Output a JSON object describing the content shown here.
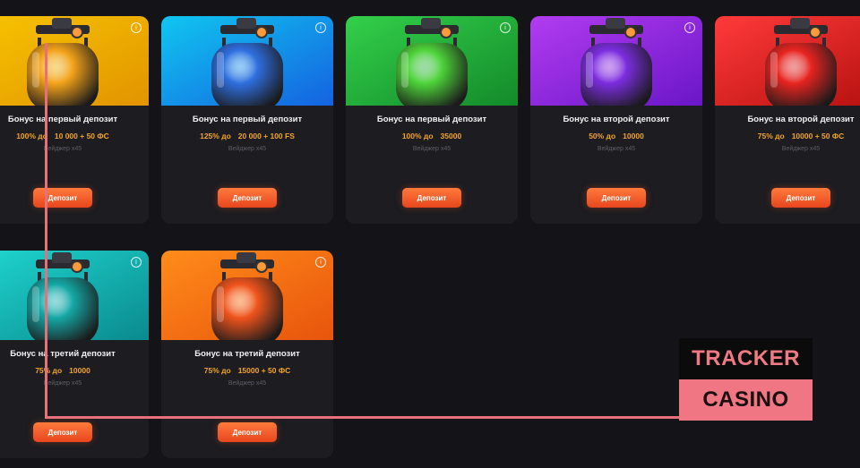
{
  "cards": [
    {
      "title": "Бонус на первый депозит",
      "percent": "100% до",
      "amount": "10 000 + 50 ФС",
      "wager": "Вейджер х45",
      "button": "Депозит",
      "info_icon": "i",
      "bg_from": "#f7c400",
      "bg_to": "#e29400",
      "bottle": "#f3a21a"
    },
    {
      "title": "Бонус на первый депозит",
      "percent": "125% до",
      "amount": "20 000 + 100 FS",
      "wager": "Вейджер х45",
      "button": "Депозит",
      "info_icon": "i",
      "bg_from": "#10c6f0",
      "bg_to": "#1562e0",
      "bottle": "#2f6fe0"
    },
    {
      "title": "Бонус на первый депозит",
      "percent": "100% до",
      "amount": "35000",
      "wager": "Вейджер х45",
      "button": "Депозит",
      "info_icon": "i",
      "bg_from": "#33d04a",
      "bg_to": "#138a2a",
      "bottle": "#4ed43a"
    },
    {
      "title": "Бонус на второй депозит",
      "percent": "50% до",
      "amount": "10000",
      "wager": "Вейджер х45",
      "button": "Депозит",
      "info_icon": "i",
      "bg_from": "#b23cf0",
      "bg_to": "#6a16c8",
      "bottle": "#7c2de0"
    },
    {
      "title": "Бонус на второй депозит",
      "percent": "75% до",
      "amount": "10000 + 50 ФС",
      "wager": "Вейджер х45",
      "button": "Депозит",
      "info_icon": "i",
      "bg_from": "#ff3a3a",
      "bg_to": "#b3100e",
      "bottle": "#e82420"
    },
    {
      "title": "Бонус на третий депозит",
      "percent": "75% до",
      "amount": "10000",
      "wager": "Вейджер х45",
      "button": "Депозит",
      "info_icon": "i",
      "bg_from": "#1fd6d0",
      "bg_to": "#0a8a8e",
      "bottle": "#15a8a6"
    },
    {
      "title": "Бонус на третий депозит",
      "percent": "75% до",
      "amount": "15000 + 50 ФС",
      "wager": "Вейджер х45",
      "button": "Депозит",
      "info_icon": "i",
      "bg_from": "#ff8c1a",
      "bg_to": "#e8540c",
      "bottle": "#f0541c"
    }
  ],
  "watermark": {
    "top": "TRACKER",
    "bottom": "CASINO"
  },
  "colors": {
    "accent_orange": "#f4a526",
    "button": "#f05a28",
    "overlay_line": "#e8707a"
  }
}
